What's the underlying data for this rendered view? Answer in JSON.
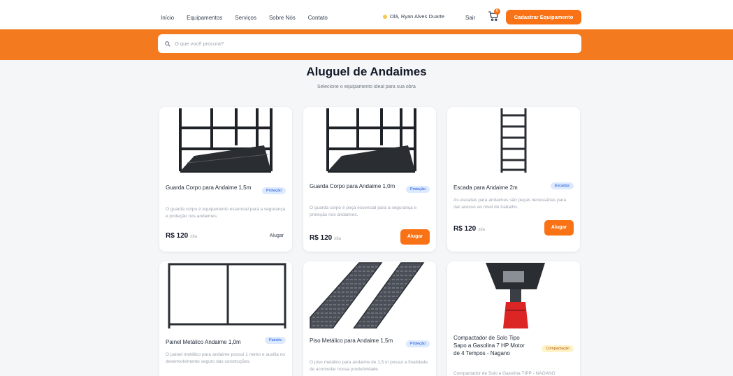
{
  "nav": {
    "links": [
      "Início",
      "Equipamentos",
      "Serviços",
      "Sobre Nós",
      "Contato"
    ],
    "user_label": "Olá, Ryan Alves Duarte",
    "logout": "Sair",
    "cart_count": "0",
    "cta": "Cadastrar Equipamento",
    "cart_icon": "cart-icon",
    "user_icon": "user-status-icon"
  },
  "search": {
    "placeholder": "O que você procura?",
    "value": ""
  },
  "page": {
    "title": "Aluguel de Andaimes",
    "subtitle": "Selecione o equipamento ideal para sua obra"
  },
  "colors": {
    "accent": "#f37a1f",
    "button": "#f97316",
    "background": "#f5f6f8"
  },
  "cards": [
    {
      "title": "Guarda Corpo para Andaime 1,5m",
      "badge": "Proteção",
      "desc": "O guarda corpo é equipamento essencial para a segurança e proteção nos andaimes.",
      "price": "R$ 120",
      "unit": "/dia",
      "action": "Alugar"
    },
    {
      "title": "Guarda Corpo para Andaime 1,0m",
      "badge": "Proteção",
      "desc": "O guarda corpo é peça essencial para a segurança e proteção nos andaimes.",
      "price": "R$ 120",
      "unit": "/dia",
      "action": "Alugar"
    },
    {
      "title": "Escada para Andaime 2m",
      "badge": "Escadas",
      "desc": "As escadas para andaimes são peças necessárias para dar acesso ao nível de trabalho.",
      "price": "R$ 120",
      "unit": "/dia",
      "action": "Alugar"
    },
    {
      "title": "Painel Metálico Andaime 1,0m",
      "badge": "Painéis",
      "desc": "O painel metálico para andaime possui 1 metro e auxilia no desenvolvimento seguro das construções."
    },
    {
      "title": "Piso Metálico para Andaime 1,5m",
      "badge": "Proteção",
      "desc": "O piso metálico para andaime de 1,5 m possui a finalidade de acomodar nossa produtividade."
    },
    {
      "title": "Compactador de Solo Tipo Sapo a Gasolina 7 HP Motor de 4 Tempos - Nagano",
      "badge": "Compactação",
      "desc": "Compactador de Solo a Gasolina TIPP - NAGANO"
    }
  ]
}
